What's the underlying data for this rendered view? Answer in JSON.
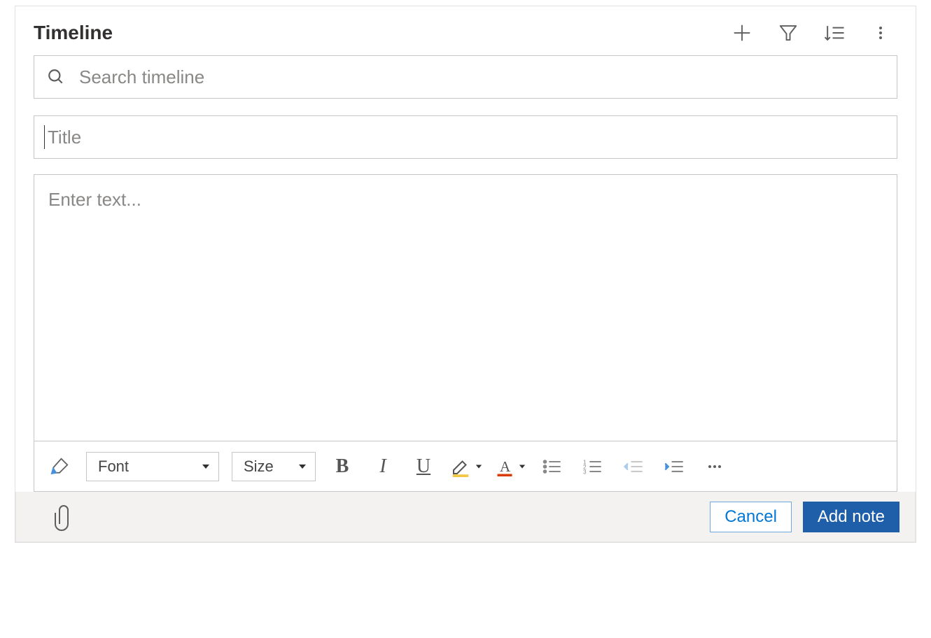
{
  "header": {
    "title": "Timeline"
  },
  "search": {
    "placeholder": "Search timeline",
    "value": ""
  },
  "note": {
    "title_placeholder": "Title",
    "title_value": "",
    "body_placeholder": "Enter text...",
    "body_value": ""
  },
  "rte_toolbar": {
    "font_label": "Font",
    "size_label": "Size"
  },
  "footer": {
    "cancel_label": "Cancel",
    "add_note_label": "Add note"
  }
}
